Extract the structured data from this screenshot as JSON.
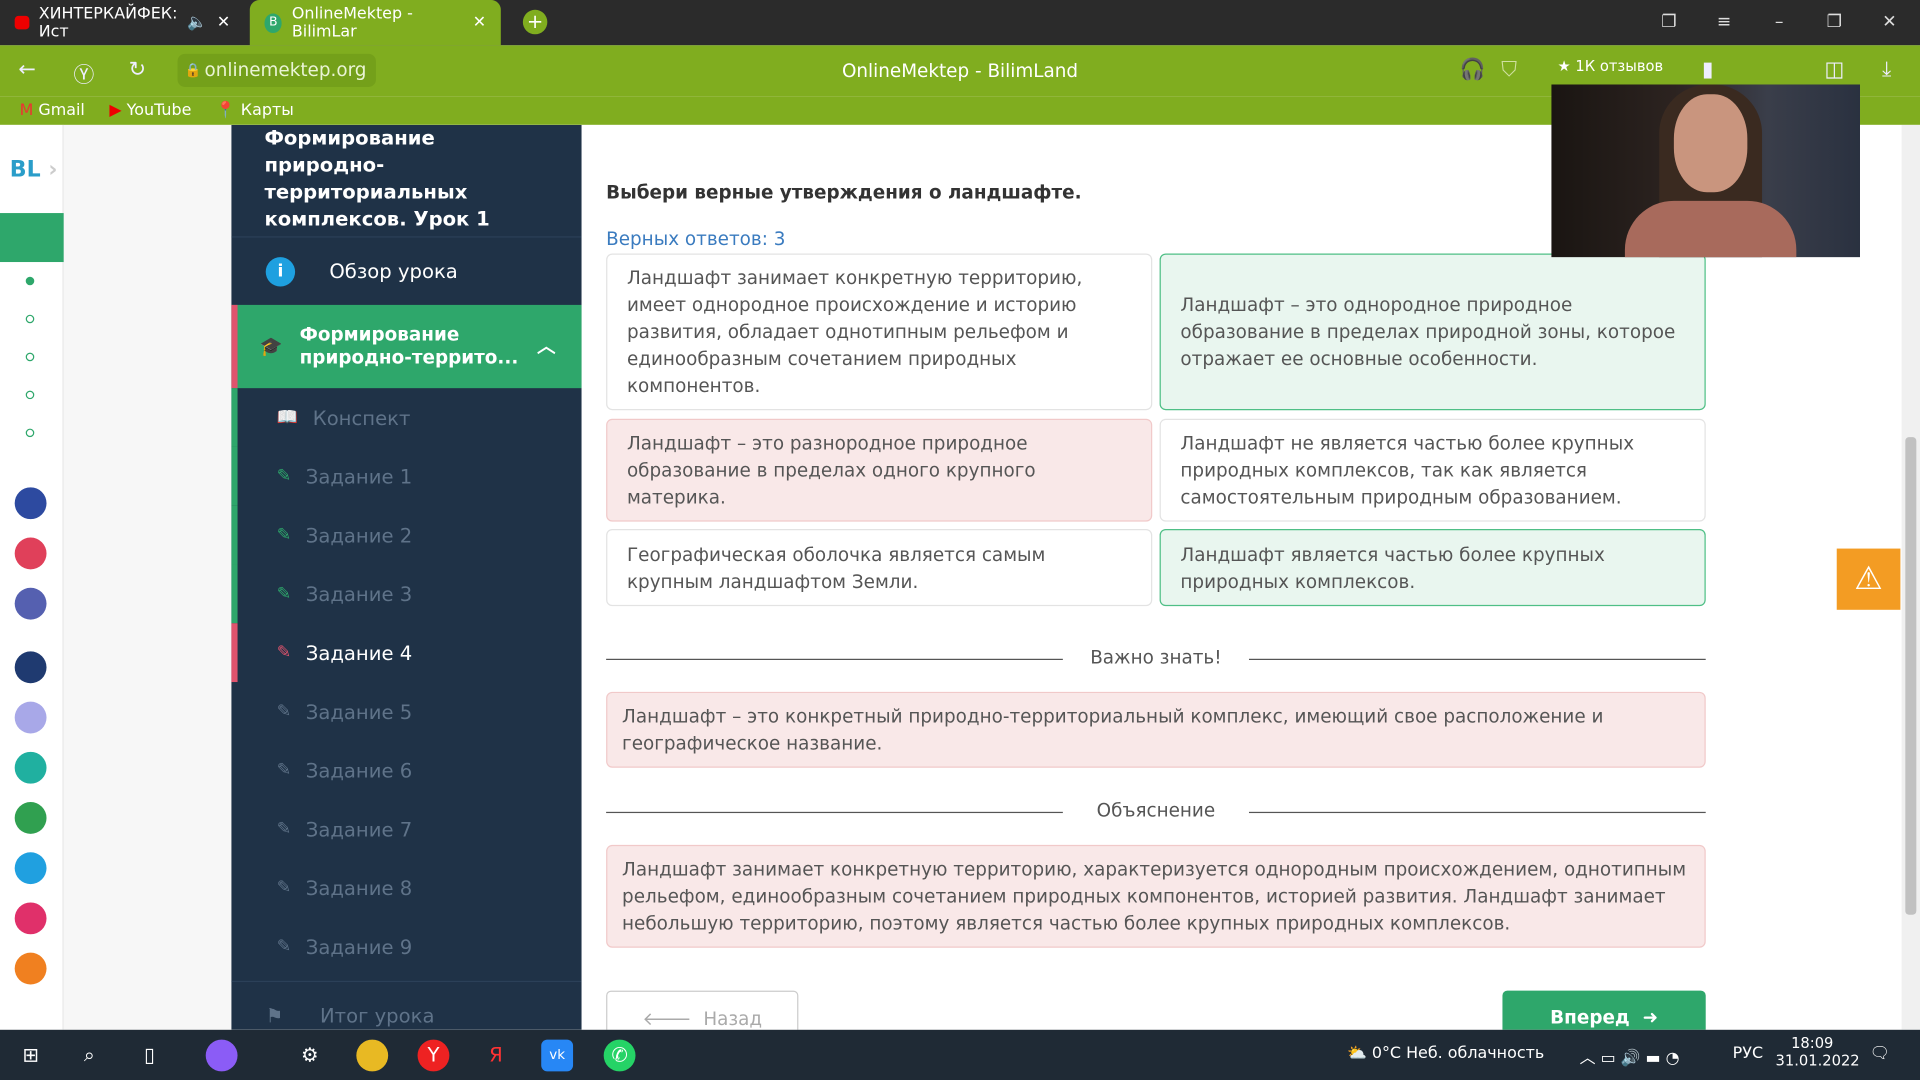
{
  "browser": {
    "tabs": [
      {
        "label": "ХИНТЕРКАЙФЕК: Ист",
        "icon": "youtube-icon",
        "audio": true
      },
      {
        "label": "OnlineMektep - BilimLar",
        "icon": "bilimland-icon",
        "active": true
      }
    ],
    "url": "onlinemektep.org",
    "page_title": "OnlineMektep - BilimLand",
    "reviews": "1К отзывов",
    "bookmarks": [
      "Gmail",
      "YouTube",
      "Карты"
    ],
    "accent": "#80ad1f"
  },
  "rail": {
    "logo": "BL"
  },
  "sidebar": {
    "lesson_title": "Формирование природно-территориальных комплексов. Урок 1",
    "overview": "Обзор урока",
    "section": "Формирование природно-террито...",
    "items": [
      {
        "label": "Конспект",
        "state": "done"
      },
      {
        "label": "Задание 1",
        "state": "done"
      },
      {
        "label": "Задание 2",
        "state": "done"
      },
      {
        "label": "Задание 3",
        "state": "done"
      },
      {
        "label": "Задание 4",
        "state": "current"
      },
      {
        "label": "Задание 5",
        "state": "open"
      },
      {
        "label": "Задание 6",
        "state": "locked"
      },
      {
        "label": "Задание 7",
        "state": "locked"
      },
      {
        "label": "Задание 8",
        "state": "locked"
      },
      {
        "label": "Задание 9",
        "state": "locked"
      }
    ],
    "final": "Итог урока"
  },
  "main": {
    "question": "Выбери верные утверждения о ландшафте.",
    "correct_count": "Верных ответов: 3",
    "options": [
      {
        "text": "Ландшафт занимает конкретную территорию, имеет однородное происхождение и историю развития, обладает однотипным рельефом и единообразным сочетанием природных компонентов.",
        "state": "neutral"
      },
      {
        "text": "Ландшафт – это однородное природное образование в пределах природной зоны, которое отражает ее основные особенности.",
        "state": "correct"
      },
      {
        "text": "Ландшафт – это разнородное природное образование в пределах одного крупного материка.",
        "state": "wrong"
      },
      {
        "text": "Ландшафт не является частью более крупных природных комплексов, так как является самостоятельным природным образованием.",
        "state": "neutral"
      },
      {
        "text": "Географическая оболочка является самым крупным ландшафтом Земли.",
        "state": "neutral"
      },
      {
        "text": "Ландшафт является частью более крупных природных комплексов.",
        "state": "correct"
      }
    ],
    "important_heading": "Важно знать!",
    "important_text": "Ландшафт – это конкретный природно-территориальный комплекс, имеющий свое расположение и географическое название.",
    "explanation_heading": "Объяснение",
    "explanation_text": "Ландшафт занимает конкретную территорию, характеризуется однородным происхождением, однотипным рельефом, единообразным сочетанием природных компонентов, историей развития. Ландшафт занимает небольшую территорию, поэтому является частью более крупных природных комплексов.",
    "back": "Назад",
    "next": "Вперед"
  },
  "taskbar": {
    "weather": "0°C  Неб. облачность",
    "lang": "РУС",
    "time": "18:09",
    "date": "31.01.2022"
  }
}
